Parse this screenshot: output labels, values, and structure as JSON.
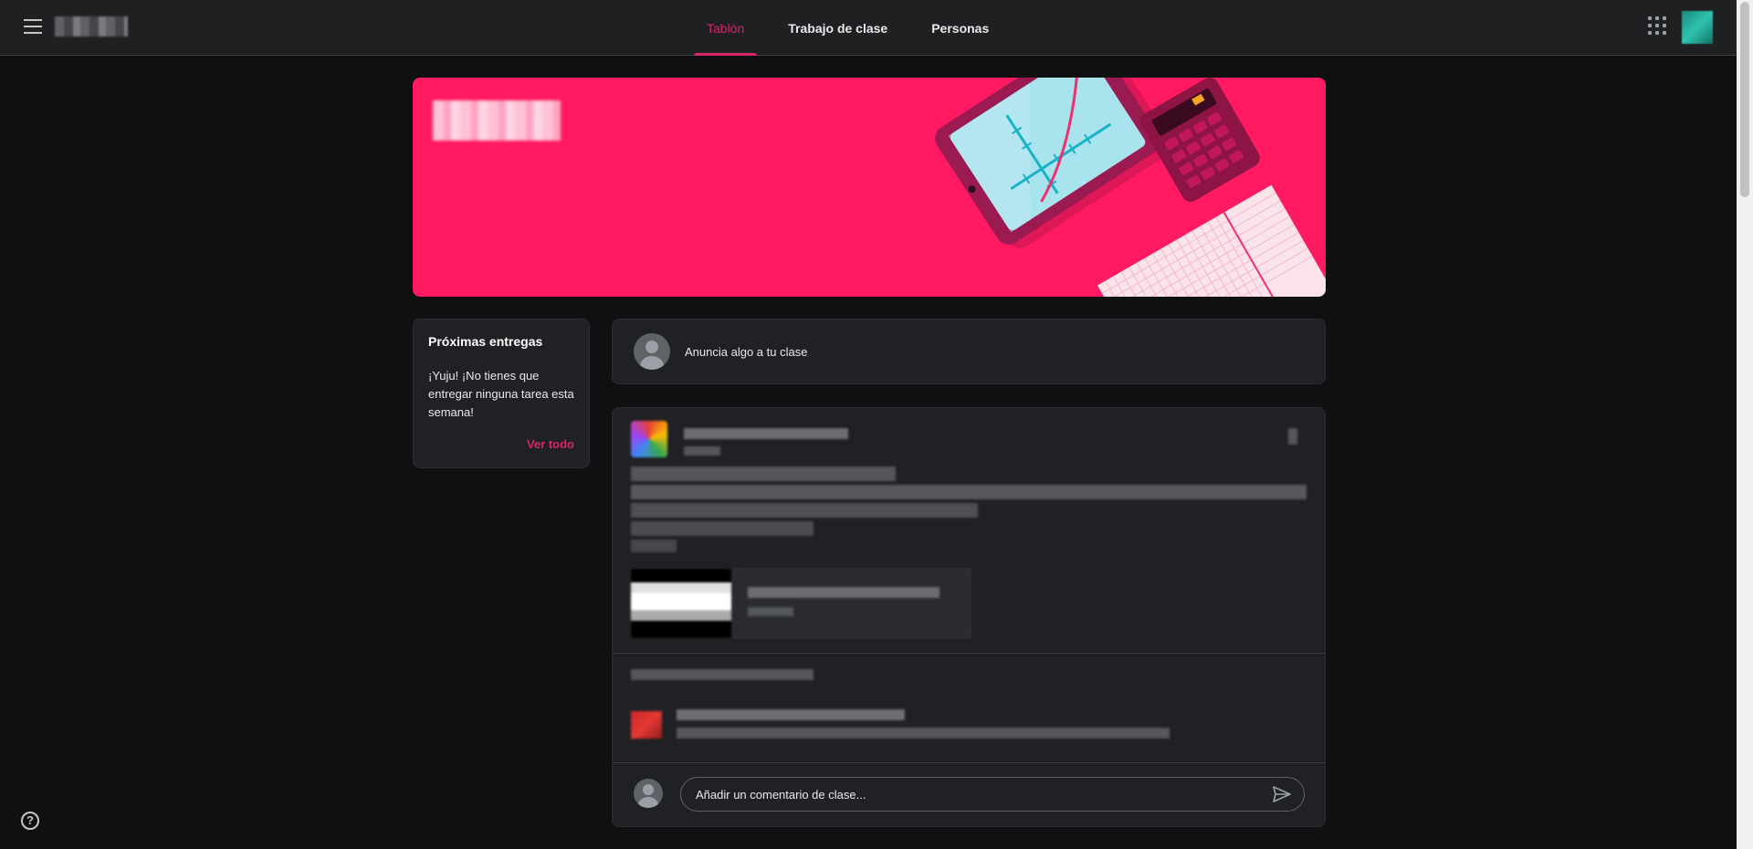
{
  "header": {
    "tabs": [
      {
        "label": "Tablón",
        "active": true
      },
      {
        "label": "Trabajo de clase",
        "active": false
      },
      {
        "label": "Personas",
        "active": false
      }
    ],
    "icons": {
      "menu": "hamburger-menu-icon",
      "apps": "apps-grid-icon"
    }
  },
  "upcoming": {
    "title": "Próximas entregas",
    "message": "¡Yuju! ¡No tienes que entregar ninguna tarea esta semana!",
    "view_all": "Ver todo"
  },
  "announce": {
    "placeholder": "Anuncia algo a tu clase"
  },
  "post": {
    "comment_placeholder": "Añadir un comentario de clase..."
  },
  "colors": {
    "accent": "#d7246b",
    "banner": "#ff1a62",
    "background": "#0f1011",
    "card": "#202124"
  }
}
